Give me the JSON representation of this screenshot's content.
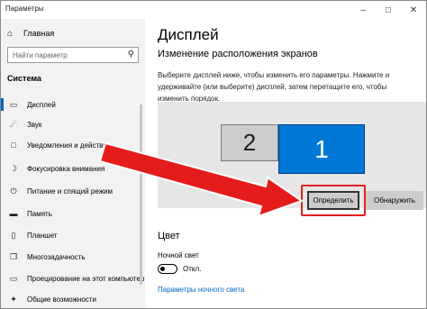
{
  "window": {
    "title": "Параметры"
  },
  "sidebar": {
    "home": "Главная",
    "search_placeholder": "Найти параметр",
    "section": "Система",
    "items": [
      {
        "label": "Дисплей",
        "icon": "monitor-icon"
      },
      {
        "label": "Звук",
        "icon": "speaker-icon"
      },
      {
        "label": "Уведомления и действия",
        "icon": "notification-icon"
      },
      {
        "label": "Фокусировка внимания",
        "icon": "moon-icon"
      },
      {
        "label": "Питание и спящий режим",
        "icon": "power-icon"
      },
      {
        "label": "Память",
        "icon": "storage-icon"
      },
      {
        "label": "Планшет",
        "icon": "tablet-icon"
      },
      {
        "label": "Многозадачность",
        "icon": "multitask-icon"
      },
      {
        "label": "Проецирование на этот компьютер",
        "icon": "projector-icon"
      },
      {
        "label": "Общие возможности",
        "icon": "share-icon"
      }
    ]
  },
  "main": {
    "title": "Дисплей",
    "subtitle": "Изменение расположения экранов",
    "description": "Выберите дисплей ниже, чтобы изменить его параметры. Нажмите и удерживайте (или выберите) дисплей, затем перетащите его, чтобы изменить порядок.",
    "monitors": [
      {
        "label": "2"
      },
      {
        "label": "1"
      }
    ],
    "identify_button": "Определить",
    "detect_button": "Обнаружить",
    "color_heading": "Цвет",
    "night_light_label": "Ночной свет",
    "toggle_state": "Откл.",
    "night_light_link": "Параметры ночного света"
  },
  "colors": {
    "accent": "#0078d7",
    "highlight": "#e02020"
  }
}
